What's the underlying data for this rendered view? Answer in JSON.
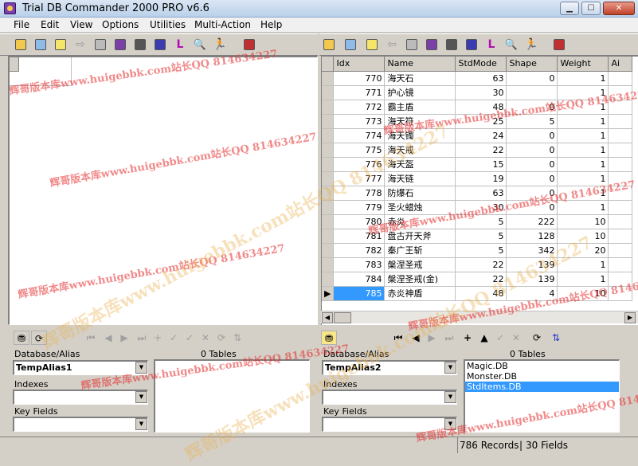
{
  "window": {
    "title": "Trial DB Commander 2000 PRO v6.6",
    "controls": [
      "minimize",
      "maximize",
      "close"
    ]
  },
  "menu": [
    "File",
    "Edit",
    "View",
    "Options",
    "Utilities",
    "Multi-Action",
    "Help"
  ],
  "grid": {
    "columns": [
      "Idx",
      "Name",
      "StdMode",
      "Shape",
      "Weight",
      "Ai"
    ],
    "rows": [
      {
        "idx": "770",
        "name": "海天石",
        "stdmode": "63",
        "shape": "0",
        "weight": "1"
      },
      {
        "idx": "771",
        "name": "护心镜",
        "stdmode": "30",
        "shape": "",
        "weight": "1"
      },
      {
        "idx": "772",
        "name": "霸主盾",
        "stdmode": "48",
        "shape": "0",
        "weight": "1"
      },
      {
        "idx": "773",
        "name": "海天符",
        "stdmode": "25",
        "shape": "5",
        "weight": "1"
      },
      {
        "idx": "774",
        "name": "海天镯",
        "stdmode": "24",
        "shape": "0",
        "weight": "1"
      },
      {
        "idx": "775",
        "name": "海天戒",
        "stdmode": "22",
        "shape": "0",
        "weight": "1"
      },
      {
        "idx": "776",
        "name": "海天盔",
        "stdmode": "15",
        "shape": "0",
        "weight": "1"
      },
      {
        "idx": "777",
        "name": "海天链",
        "stdmode": "19",
        "shape": "0",
        "weight": "1"
      },
      {
        "idx": "778",
        "name": "防爆石",
        "stdmode": "63",
        "shape": "0",
        "weight": "1"
      },
      {
        "idx": "779",
        "name": "圣火蜡烛",
        "stdmode": "30",
        "shape": "0",
        "weight": "1"
      },
      {
        "idx": "780",
        "name": "赤炎",
        "stdmode": "5",
        "shape": "222",
        "weight": "10"
      },
      {
        "idx": "781",
        "name": "盘古开天斧",
        "stdmode": "5",
        "shape": "128",
        "weight": "10"
      },
      {
        "idx": "782",
        "name": "秦广王斩",
        "stdmode": "5",
        "shape": "342",
        "weight": "20"
      },
      {
        "idx": "783",
        "name": "槃涅圣戒",
        "stdmode": "22",
        "shape": "139",
        "weight": "1"
      },
      {
        "idx": "784",
        "name": "槃涅圣戒(金)",
        "stdmode": "22",
        "shape": "139",
        "weight": "1"
      },
      {
        "idx": "785",
        "name": "赤炎神盾",
        "stdmode": "48",
        "shape": "4",
        "weight": "10"
      }
    ]
  },
  "left_panel": {
    "db_alias_label": "Database/Alias",
    "tables_count": "0 Tables",
    "alias_value": "TempAlias1",
    "indexes_label": "Indexes",
    "key_fields_label": "Key Fields"
  },
  "right_panel": {
    "db_alias_label": "Database/Alias",
    "tables_count": "0 Tables",
    "alias_value": "TempAlias2",
    "indexes_label": "Indexes",
    "key_fields_label": "Key Fields",
    "tables": [
      "Magic.DB",
      "Monster.DB",
      "StdItems.DB"
    ]
  },
  "status": {
    "records": "786 Records",
    "fields": "30 Fields"
  },
  "watermarks": {
    "text_a": "辉哥版本库www.huigebbk.com站长QQ 814634227",
    "text_b": "辉哥版本库www.huigebbk.com站长QQ 814634227",
    "text_c": "辉哥版本库www.huigebbk.com站长QQ 814634227"
  }
}
